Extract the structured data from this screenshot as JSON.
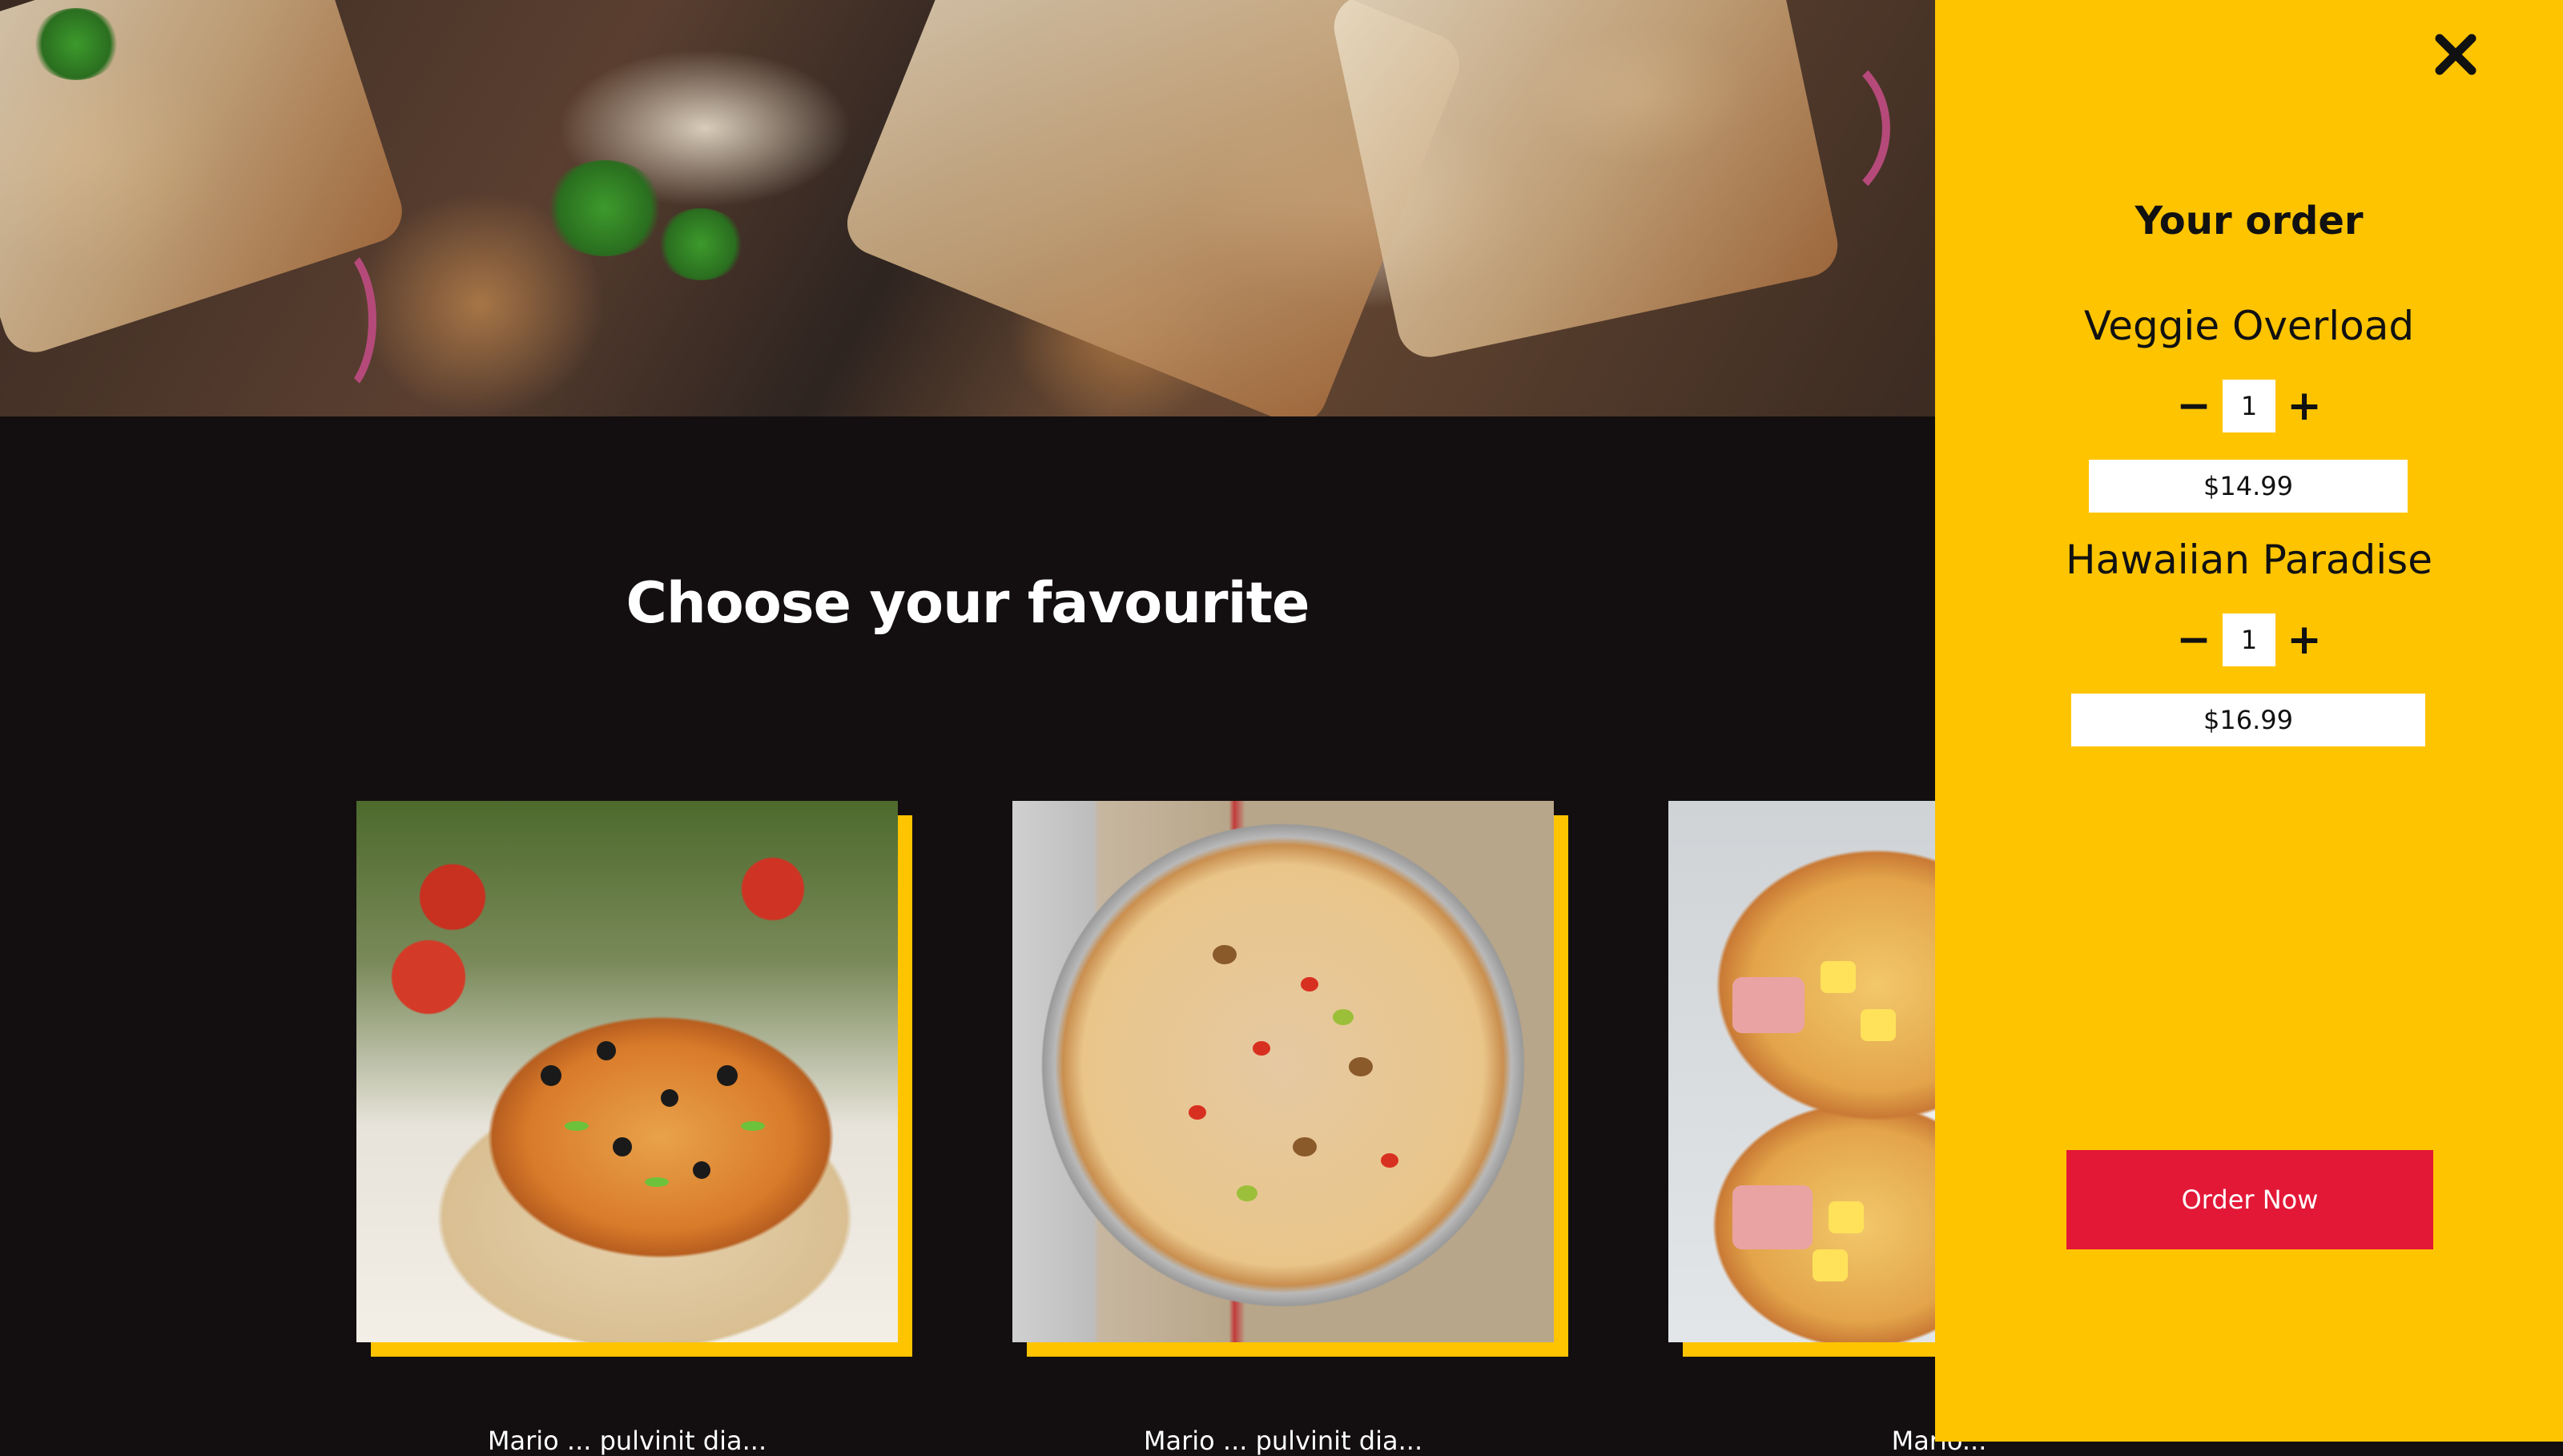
{
  "hero": {
    "image": "pizza-slices-hero-photo"
  },
  "menu": {
    "heading": "Choose your favourite",
    "cards": [
      {
        "image": "supreme-pizza-photo",
        "caption": "Mario ... pulvinit dia..."
      },
      {
        "image": "veggie-pizza-photo",
        "caption": "Mario ... pulvinit dia..."
      },
      {
        "image": "hawaiian-pizza-photo",
        "caption": "Mario..."
      }
    ]
  },
  "order": {
    "title": "Your order",
    "close_icon": "close-icon",
    "items": [
      {
        "name": "Veggie Overload",
        "qty": "1",
        "price": "$14.99",
        "minus": "−",
        "plus": "+"
      },
      {
        "name": "Hawaiian Paradise",
        "qty": "1",
        "price": "$16.99",
        "minus": "−",
        "plus": "+"
      }
    ],
    "order_button": "Order Now"
  },
  "colors": {
    "accent": "#ffc400",
    "cta": "#e31837",
    "background": "#130f10"
  }
}
